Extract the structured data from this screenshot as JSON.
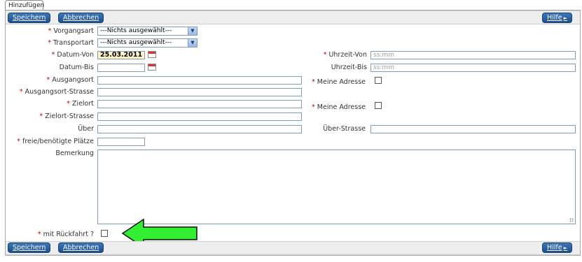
{
  "tab": {
    "label": "Hinzufügen"
  },
  "toolbar": {
    "save_label": "Speichern",
    "cancel_label": "Abbrechen",
    "help_label": "Hilfe",
    "help_arrow": "►"
  },
  "form": {
    "vorgangsart": {
      "label": "Vorgangsart",
      "required": "*",
      "value": "---Nichts ausgewählt---"
    },
    "transportart": {
      "label": "Transportart",
      "required": "*",
      "value": "---Nichts ausgewählt---"
    },
    "datum_von": {
      "label": "Datum-Von",
      "required": "*",
      "value": "25.03.2011"
    },
    "uhrzeit_von": {
      "label": "Uhrzeit-Von",
      "required": "*",
      "placeholder": "ss:mm"
    },
    "datum_bis": {
      "label": "Datum-Bis",
      "value": ""
    },
    "uhrzeit_bis": {
      "label": "Uhrzeit-Bis",
      "placeholder": "ss:mm"
    },
    "ausgangsort": {
      "label": "Ausgangsort",
      "required": "*",
      "value": ""
    },
    "meine_adresse_1": {
      "label": "Meine Adresse",
      "required": "*",
      "checked": false
    },
    "ausgangsort_strasse": {
      "label": "Ausgangsort-Strasse",
      "required": "*",
      "value": ""
    },
    "zielort": {
      "label": "Zielort",
      "required": "*",
      "value": ""
    },
    "meine_adresse_2": {
      "label": "Meine Adresse",
      "required": "*",
      "checked": false
    },
    "zielort_strasse": {
      "label": "Zielort-Strasse",
      "required": "*",
      "value": ""
    },
    "ueber": {
      "label": "Über",
      "value": ""
    },
    "ueber_strasse": {
      "label": "Über-Strasse",
      "value": ""
    },
    "plaetze": {
      "label": "freie/benötigte Plätze",
      "required": "*",
      "value": ""
    },
    "bemerkung": {
      "label": "Bemerkung",
      "value": ""
    },
    "rueckfahrt": {
      "label": "mit Rückfahrt ?",
      "required": "*",
      "checked": false
    }
  },
  "annotation": {
    "arrow_color": "#33ee33",
    "arrow_icon": "left-arrow"
  },
  "colors": {
    "button": "#2a5fa0",
    "required": "#c00000",
    "date_highlight": "#fff4c8"
  }
}
